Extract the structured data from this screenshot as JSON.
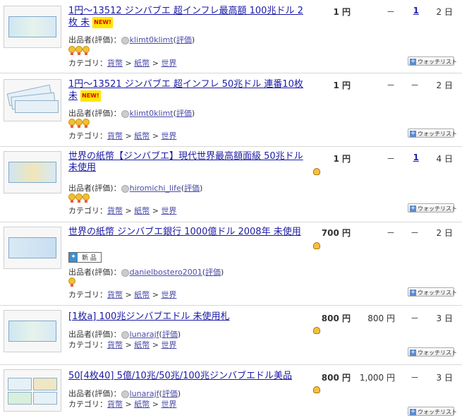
{
  "watch_label": "ウォッチリスト",
  "seller_prefix": "出品者(評価)：",
  "category_prefix": "カテゴリ：",
  "sep": " > ",
  "items": [
    {
      "title": "1円～13512 ジンバブエ 超インフレ最高額 100兆ドル 2枚 未",
      "new_badge": "NEW!",
      "seller": "klimt0klimt",
      "rating_label": "評価",
      "categories": [
        "貨幣",
        "紙幣",
        "世界"
      ],
      "price": "1 円",
      "buynow": "－",
      "bids": "1",
      "days": "2 日"
    },
    {
      "title": "1円～13521 ジンバブエ 超インフレ 50兆ドル 連番10枚 未",
      "new_badge": "NEW!",
      "seller": "klimt0klimt",
      "rating_label": "評価",
      "categories": [
        "貨幣",
        "紙幣",
        "世界"
      ],
      "price": "1 円",
      "buynow": "－",
      "bids": "－",
      "days": "2 日"
    },
    {
      "title": "世界の紙幣【ジンバブエ】現代世界最高額面級 50兆ドル 未使用",
      "seller": "hiromichi_life",
      "rating_label": "評価",
      "categories": [
        "貨幣",
        "紙幣",
        "世界"
      ],
      "price": "1 円",
      "buynow": "－",
      "bids": "1",
      "days": "4 日"
    },
    {
      "title": "世界の紙幣 ジンバブエ銀行 1000億ドル 2008年 未使用",
      "new_product": "新 品",
      "seller": "danielbostero2001",
      "rating_label": "評価",
      "categories": [
        "貨幣",
        "紙幣",
        "世界"
      ],
      "price": "700 円",
      "buynow": "－",
      "bids": "－",
      "days": "2 日"
    },
    {
      "title": "[1枚a] 100兆ジンバブエドル 未使用札",
      "seller": "lunarajf",
      "rating_label": "評価",
      "categories": [
        "貨幣",
        "紙幣",
        "世界"
      ],
      "price": "800 円",
      "buynow": "800 円",
      "bids": "－",
      "days": "3 日"
    },
    {
      "title": "50[4枚40] 5億/10兆/50兆/100兆ジンバブエドル美品",
      "seller": "lunarajf",
      "rating_label": "評価",
      "categories": [
        "貨幣",
        "紙幣",
        "世界"
      ],
      "price": "800 円",
      "buynow": "1,000 円",
      "bids": "－",
      "days": "3 日"
    }
  ]
}
